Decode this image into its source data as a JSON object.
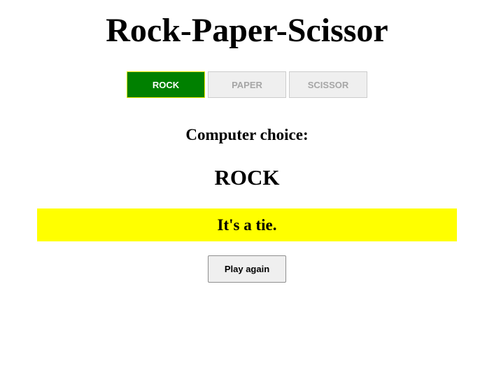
{
  "title": "Rock-Paper-Scissor",
  "choices": [
    {
      "label": "ROCK",
      "selected": true
    },
    {
      "label": "PAPER",
      "selected": false
    },
    {
      "label": "SCISSOR",
      "selected": false
    }
  ],
  "computer": {
    "label": "Computer choice:",
    "value": "ROCK"
  },
  "result": {
    "text": "It's a tie.",
    "color": "#ffff00"
  },
  "play_again_label": "Play again",
  "colors": {
    "selected_button": "#008000",
    "selected_text": "#ffffff",
    "disabled_text": "#a6a6a6"
  }
}
